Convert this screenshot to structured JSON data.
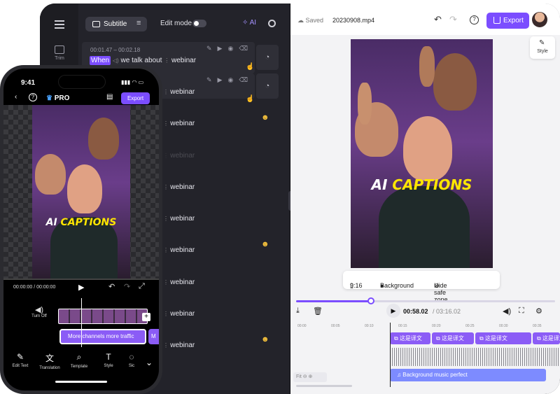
{
  "desktop": {
    "sidebar": {
      "trim_label": "Trim"
    },
    "toolbar": {
      "subtitle_tab": "Subtitle",
      "edit_mode_label": "Edit mode",
      "ai_label": "AI"
    },
    "subtitles": {
      "row1_time_start": "00:01.47",
      "row1_time_end": "00:02.18",
      "row1_highlight": "When",
      "row1_rest": "we talk about",
      "row1_word": "webinar",
      "rows": [
        "webinar",
        "webinar",
        "webinar",
        "webinar",
        "webinar",
        "webinar",
        "webinar",
        "webinar",
        "webinar",
        "webinar"
      ]
    },
    "header": {
      "saved": "Saved",
      "filename": "20230908.mp4",
      "export": "Export"
    },
    "style_label": "Style",
    "caption": {
      "white": "AI",
      "yellow": "CAPTIONS"
    },
    "video_options": {
      "ratio": "9:16",
      "background": "Background",
      "safe_zone": "Hide safe zone"
    },
    "playback": {
      "current": "00:58.02",
      "duration": "03:16.02",
      "progress": 0.29
    },
    "ruler": [
      "00:00",
      "00:05",
      "00:10",
      "00:15",
      "00:20",
      "00:25",
      "00:30",
      "00:35"
    ],
    "caption_clips": [
      "这是译文",
      "这是译文",
      "这是译文",
      "这是译文"
    ],
    "music_clip": "Background music perfect",
    "zoom_label": "Fit"
  },
  "phone": {
    "time": "9:41",
    "pro": "PRO",
    "export": "Export",
    "caption": {
      "white": "AI",
      "yellow": "CAPTIONS"
    },
    "timecode": "00:00:00 / 00:00:00",
    "turn_off": "Turn Off",
    "clip_text": "More channels more traffic",
    "clip_text2": "M",
    "tools": [
      "Edit Text",
      "Translation",
      "Template",
      "Style",
      "Sic"
    ]
  },
  "colors": {
    "accent": "#7b4dff",
    "caption_yellow": "#ffe600",
    "dark_panel": "#23232a"
  }
}
